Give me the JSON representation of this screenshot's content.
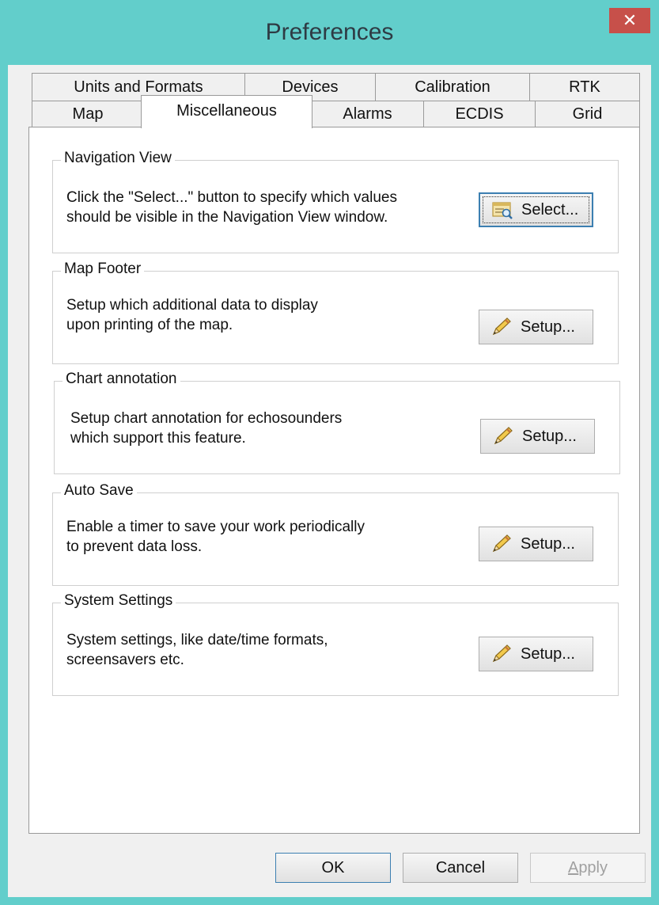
{
  "window": {
    "title": "Preferences",
    "close_label": "✕"
  },
  "tabs_row1": [
    {
      "label": "Units and Formats"
    },
    {
      "label": "Devices"
    },
    {
      "label": "Calibration"
    },
    {
      "label": "RTK"
    }
  ],
  "tabs_row2": [
    {
      "label": "Map"
    },
    {
      "label": "Miscellaneous",
      "selected": true
    },
    {
      "label": "Alarms"
    },
    {
      "label": "ECDIS"
    },
    {
      "label": "Grid"
    }
  ],
  "groups": [
    {
      "title": "Navigation View",
      "text_line1": "Click the \"Select...\" button to specify which values",
      "text_line2": "should be visible in the Navigation View window.",
      "button": "Select...",
      "icon": "select-list-icon"
    },
    {
      "title": "Map Footer",
      "text_line1": "Setup which additional data to display",
      "text_line2": "upon printing of the map.",
      "button": "Setup...",
      "icon": "pencil-icon"
    },
    {
      "title": "Chart annotation",
      "text_line1": "Setup chart annotation for echosounders",
      "text_line2": "which support this feature.",
      "button": "Setup...",
      "icon": "pencil-icon"
    },
    {
      "title": "Auto Save",
      "text_line1": "Enable a timer to save your work periodically",
      "text_line2": "to prevent data loss.",
      "button": "Setup...",
      "icon": "pencil-icon"
    },
    {
      "title": "System Settings",
      "text_line1": "System settings, like date/time formats,",
      "text_line2": "screensavers etc.",
      "button": "Setup...",
      "icon": "pencil-icon"
    }
  ],
  "buttons": {
    "ok": "OK",
    "cancel": "Cancel",
    "apply": "Apply"
  },
  "colors": {
    "titlebar": "#62cecb",
    "close": "#c7504a",
    "focus": "#3c7fb1"
  }
}
